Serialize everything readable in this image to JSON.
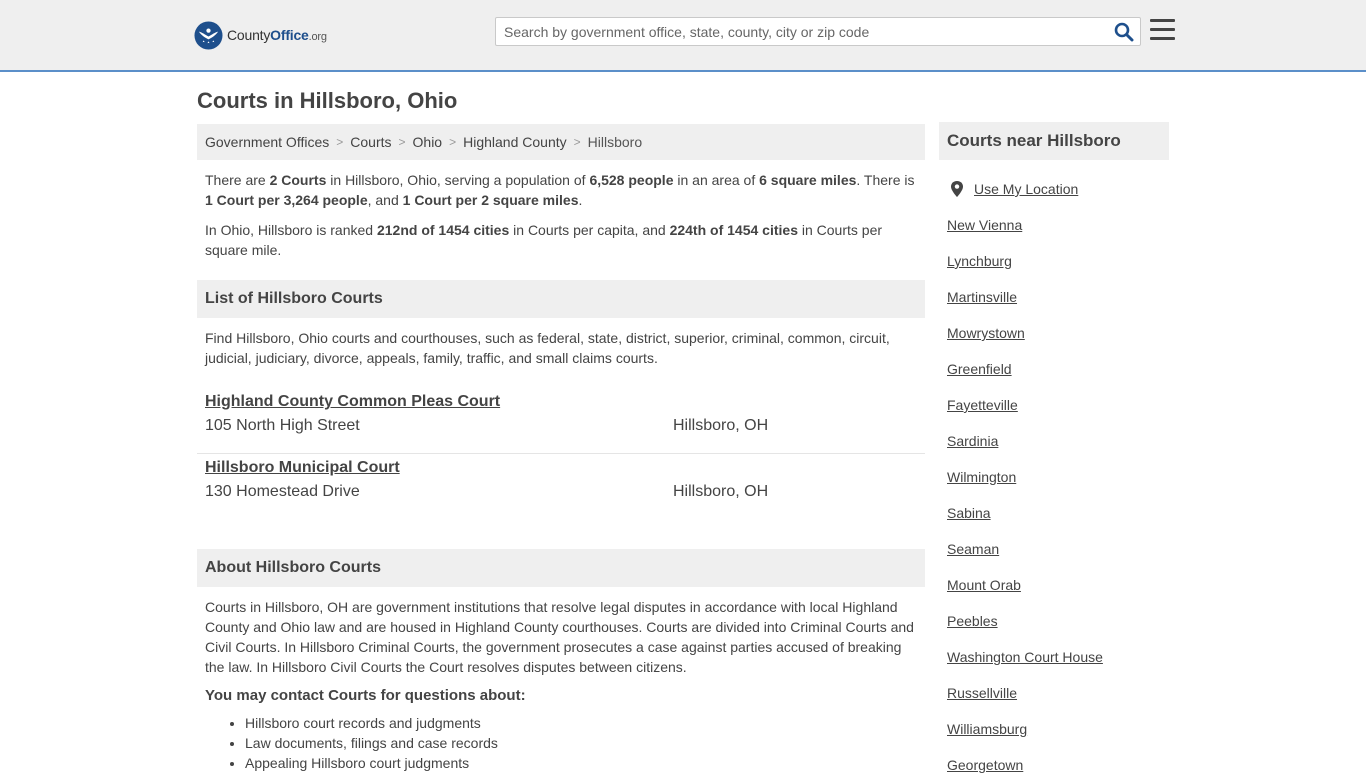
{
  "header": {
    "logo": {
      "name": "County",
      "name_bold": "Office",
      "tld": ".org"
    },
    "search": {
      "placeholder": "Search by government office, state, county, city or zip code",
      "value": ""
    }
  },
  "page": {
    "title": "Courts in Hillsboro, Ohio"
  },
  "breadcrumb": [
    {
      "label": "Government Offices"
    },
    {
      "label": "Courts"
    },
    {
      "label": "Ohio"
    },
    {
      "label": "Highland County"
    },
    {
      "label": "Hillsboro"
    }
  ],
  "intro": {
    "p1": {
      "t1": "There are ",
      "b1": "2 Courts",
      "t2": " in Hillsboro, Ohio, serving a population of ",
      "b2": "6,528 people",
      "t3": " in an area of ",
      "b3": "6 square miles",
      "t4": ". There is ",
      "b4": "1 Court per 3,264 people",
      "t5": ", and ",
      "b5": "1 Court per 2 square miles",
      "t6": "."
    },
    "p2": {
      "t1": "In Ohio, Hillsboro is ranked ",
      "b1": "212nd of 1454 cities",
      "t2": " in Courts per capita, and ",
      "b2": "224th of 1454 cities",
      "t3": " in Courts per square mile."
    }
  },
  "list_section": {
    "heading": "List of Hillsboro Courts",
    "description": "Find Hillsboro, Ohio courts and courthouses, such as federal, state, district, superior, criminal, common, circuit, judicial, judiciary, divorce, appeals, family, traffic, and small claims courts.",
    "courts": [
      {
        "name": "Highland County Common Pleas Court",
        "address": "105 North High Street",
        "city": "Hillsboro, OH"
      },
      {
        "name": "Hillsboro Municipal Court",
        "address": "130 Homestead Drive",
        "city": "Hillsboro, OH"
      }
    ]
  },
  "about_section": {
    "heading": "About Hillsboro Courts",
    "text": "Courts in Hillsboro, OH are government institutions that resolve legal disputes in accordance with local Highland County and Ohio law and are housed in Highland County courthouses. Courts are divided into Criminal Courts and Civil Courts. In Hillsboro Criminal Courts, the government prosecutes a case against parties accused of breaking the law. In Hillsboro Civil Courts the Court resolves disputes between citizens.",
    "contact_heading": "You may contact Courts for questions about:",
    "contact_items": [
      "Hillsboro court records and judgments",
      "Law documents, filings and case records",
      "Appealing Hillsboro court judgments"
    ]
  },
  "sidebar": {
    "heading": "Courts near Hillsboro",
    "use_location": "Use My Location",
    "cities": [
      "New Vienna",
      "Lynchburg",
      "Martinsville",
      "Mowrystown",
      "Greenfield",
      "Fayetteville",
      "Sardinia",
      "Wilmington",
      "Sabina",
      "Seaman",
      "Mount Orab",
      "Peebles",
      "Washington Court House",
      "Russellville",
      "Williamsburg",
      "Georgetown"
    ]
  },
  "colors": {
    "accent": "#1e4f8c",
    "header_bg": "#efefef",
    "header_border": "#5b8fc9",
    "text": "#444444"
  }
}
